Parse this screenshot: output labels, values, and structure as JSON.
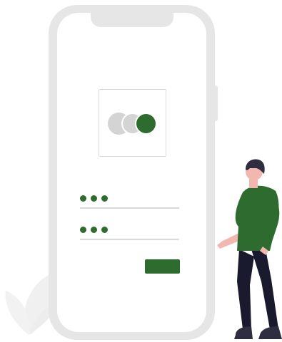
{
  "screen": {
    "submit_label": "",
    "field_mask_1": "",
    "field_mask_2": ""
  },
  "colors": {
    "accent": "#2e6b2e",
    "frame": "#e6e6e6",
    "muted_circle": "#d4d4d4",
    "field_line": "#d9d9d9",
    "person_skin": "#f2b8b0",
    "person_hair": "#2f2e41",
    "person_pants": "#1a1a2e",
    "plant": "#f0f0f0"
  },
  "icons": {
    "logo": "three-circles-logo-icon",
    "password_mask": "dots-mask-icon"
  }
}
